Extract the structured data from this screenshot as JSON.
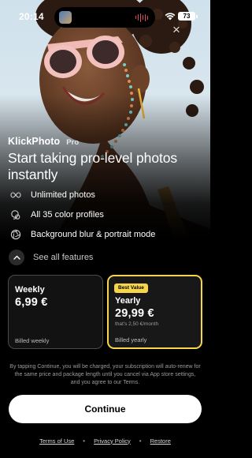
{
  "status_bar": {
    "time": "20:14",
    "battery": "73",
    "icons": [
      "now-playing-thumbnail",
      "audio-waveform-icon",
      "wifi-icon",
      "battery-icon"
    ]
  },
  "close_icon": "×",
  "brand": {
    "name": "KlickPhoto",
    "tier": "Pro"
  },
  "headline": "Start taking pro-level photos instantly",
  "features": [
    {
      "icon": "infinity-icon",
      "label": "Unlimited photos"
    },
    {
      "icon": "color-profile-icon",
      "label": "All 35 color profiles"
    },
    {
      "icon": "aperture-icon",
      "label": "Background blur & portrait mode"
    }
  ],
  "see_all": {
    "icon": "chevron-up-icon",
    "label": "See all features"
  },
  "plans": {
    "weekly": {
      "name": "Weekly",
      "price": "6,99 €",
      "billing": "Billed weekly"
    },
    "yearly": {
      "badge": "Best Value",
      "name": "Yearly",
      "price": "29,99 €",
      "sub": "that's 2,50 €/month",
      "billing": "Billed yearly"
    }
  },
  "legal": "By tapping Continue, you will be charged, your subscription will auto-renew for the same price and package length until you cancel via App store settings, and you agree to our Terms.",
  "cta": "Continue",
  "footer": {
    "terms": "Terms of Use",
    "privacy": "Privacy Policy",
    "restore": "Restore",
    "separator": "•"
  },
  "colors": {
    "accent": "#f6d54b",
    "background": "#000000",
    "cta_bg": "#ffffff"
  }
}
